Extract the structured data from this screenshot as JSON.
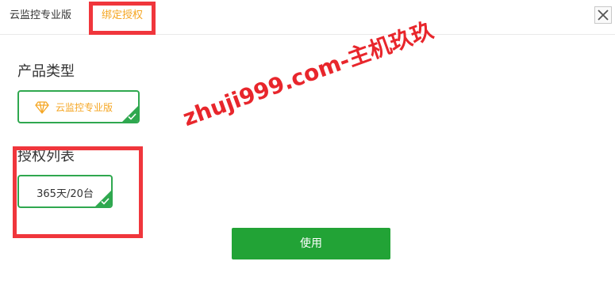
{
  "tabs": [
    {
      "label": "云监控专业版"
    },
    {
      "label": "绑定授权"
    }
  ],
  "product_type": {
    "title": "产品类型",
    "selected": {
      "label": "云监控专业版",
      "icon": "diamond-icon"
    }
  },
  "license_list": {
    "title": "授权列表",
    "selected": {
      "label": "365天/20台"
    }
  },
  "actions": {
    "use_label": "使用"
  },
  "watermark": {
    "text": "zhuji999.com-主机玖玖"
  },
  "colors": {
    "accent_green": "#22a336",
    "accent_orange": "#f5a623",
    "annotation_red": "#f0363c"
  }
}
